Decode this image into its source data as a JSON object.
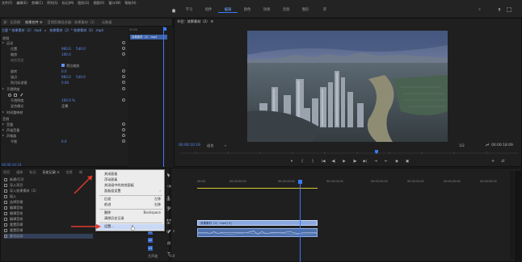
{
  "menubar": [
    "文件(F)",
    "编辑(E)",
    "剪辑(C)",
    "序列(S)",
    "标记(M)",
    "图形(G)",
    "视图(V)",
    "窗口(W)",
    "帮助(H)"
  ],
  "workspaces": {
    "tabs": [
      "学习",
      "组件",
      "编辑",
      "颜色",
      "效果",
      "音频",
      "图形",
      "库"
    ],
    "active_index": 2,
    "more": "»"
  },
  "effect_controls": {
    "tabs": [
      "源：无剪辑",
      "效果控件 ≡",
      "音频剪辑混合器：效果素材（2）",
      "元数据"
    ],
    "clip_path": [
      "主要 * 效果素材（2）.mp4",
      "效果素材（2）* 效果素材（2）.mp4"
    ],
    "clip_badge": "效果素材（2）.mp4",
    "ruler": "00:00",
    "section_video": "视频",
    "motion": "运动",
    "position_label": "位置",
    "position_x": "960.0",
    "position_y": "540.0",
    "scale_label": "缩放",
    "scale_value": "100.0",
    "scale_width_label": "缩放宽度",
    "uniform_scale": "等比缩放",
    "rotation_label": "旋转",
    "rotation_value": "0.0",
    "anchor_label": "锚点",
    "anchor_x": "960.0",
    "anchor_y": "540.0",
    "flicker_label": "防闪烁滤镜",
    "flicker_value": "0.00",
    "opacity": "不透明度",
    "opacity_label": "不透明度",
    "opacity_value": "100.0 %",
    "blend_label": "混合模式",
    "blend_value": "正常",
    "time_remap": "时间重映射",
    "section_audio": "音频",
    "volume": "音量",
    "channel_volume": "声道音量",
    "panner": "声像器",
    "balance_label": "平衡",
    "balance_value": "0.0",
    "timecode": "00:00:10:19"
  },
  "program_monitor": {
    "title": "节目：效果素材（2） ≡",
    "timecode": "00:00:10:19",
    "fit": "适合",
    "ratio": "1/2",
    "duration": "00:00:18:09",
    "transport": [
      "▾",
      "{",
      "}",
      "|◀",
      "◀|",
      "▶",
      "|▶",
      "▶|",
      "⇥",
      "⇤",
      "◉",
      "▣"
    ],
    "transport_right": [
      "+",
      "⇄"
    ]
  },
  "project_panel": {
    "tabs": [
      "项目",
      "媒体",
      "标记",
      "历史记录 ≡",
      "信息",
      "效"
    ],
    "active_tab_index": 3,
    "history": [
      "新建/打开",
      "导入项目",
      "导入效果素材（2）",
      "插入",
      "选择剪辑",
      "编辑音效",
      "编辑音效",
      "编辑音效",
      "重置剪辑",
      "重置剪辑",
      "复位运动"
    ]
  },
  "context_menu": {
    "items": [
      {
        "label": "关闭面板",
        "shortcut": ""
      },
      {
        "label": "浮动面板",
        "shortcut": ""
      },
      {
        "label": "关闭组中的其他面板",
        "shortcut": ""
      },
      {
        "label": "面板组设置",
        "shortcut": "›"
      },
      {
        "label": "后退",
        "shortcut": "左移"
      },
      {
        "label": "前进",
        "shortcut": "右移"
      },
      {
        "label": "删除",
        "shortcut": "Backspace"
      },
      {
        "label": "清除历史记录",
        "shortcut": ""
      },
      {
        "label": "设置...",
        "shortcut": ""
      }
    ]
  },
  "timeline": {
    "ruler": [
      "00:00",
      "00:00:05:00",
      "00:00:10:00",
      "00:00:15:00",
      "00:00:20:00",
      "00:00:25:00",
      "00:00:30:00",
      "00:00:35:00"
    ],
    "video_clip": "效果素材（2）.mp4 [V]",
    "tracks": [
      {
        "tag": "V3",
        "label": ""
      },
      {
        "tag": "V2",
        "label": ""
      },
      {
        "tag": "V1",
        "label": ""
      },
      {
        "tag": "A1",
        "label": ""
      },
      {
        "tag": "A2",
        "label": ""
      },
      {
        "tag": "A3",
        "label": ""
      }
    ],
    "master": "主声道",
    "master_value": "0.0"
  }
}
